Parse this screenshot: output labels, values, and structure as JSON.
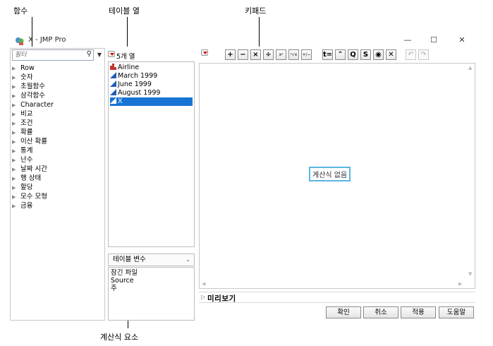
{
  "callouts": {
    "functions": "함수",
    "table_columns": "테이블 열",
    "keypad": "키패드",
    "formula_elements": "계산식 요소"
  },
  "window": {
    "title": "X - JMP Pro",
    "icon": "jmp-app-icon",
    "minimize": "—",
    "maximize": "☐",
    "close": "✕"
  },
  "functions": {
    "search_placeholder": "필터",
    "search_icon": "search-icon",
    "items": [
      "Row",
      "숫자",
      "초월함수",
      "삼각함수",
      "Character",
      "비교",
      "조건",
      "확률",
      "이산 확률",
      "통계",
      "난수",
      "날짜 시간",
      "행 상태",
      "할당",
      "모수 모형",
      "금융"
    ]
  },
  "columns": {
    "count_label": "5개 열",
    "items": [
      {
        "name": "Airline",
        "type": "nominal",
        "color": "#c0392b"
      },
      {
        "name": "March 1999",
        "type": "continuous",
        "color": "#1f5fb3"
      },
      {
        "name": "June 1999",
        "type": "continuous",
        "color": "#1f5fb3"
      },
      {
        "name": "August 1999",
        "type": "continuous",
        "color": "#1f5fb3"
      },
      {
        "name": "X",
        "type": "continuous",
        "color": "#ffffff",
        "selected": true
      }
    ]
  },
  "table_vars": {
    "select_value": "테이블 변수",
    "items": [
      "잠긴 파일",
      "Source",
      "주"
    ]
  },
  "keypad": {
    "buttons": [
      {
        "name": "add-button",
        "label": "+"
      },
      {
        "name": "subtract-button",
        "label": "−"
      },
      {
        "name": "multiply-button",
        "label": "×"
      },
      {
        "name": "divide-button",
        "label": "÷"
      },
      {
        "name": "power-button",
        "label": "xʸ"
      },
      {
        "name": "root-button",
        "label": "ʸ√x"
      },
      {
        "name": "negate-button",
        "label": "+∕−"
      },
      {
        "name": "assign-button",
        "label": "t="
      },
      {
        "name": "caret-button",
        "label": "⌃"
      },
      {
        "name": "local-button",
        "label": "Q"
      },
      {
        "name": "swap-button",
        "label": "S"
      },
      {
        "name": "peel-button",
        "label": "◉"
      },
      {
        "name": "clear-button",
        "label": "✕"
      },
      {
        "name": "undo-button",
        "label": "↶"
      },
      {
        "name": "redo-button",
        "label": "↷"
      }
    ]
  },
  "editor": {
    "empty_text": "계산식 없음",
    "preview_label": "미리보기"
  },
  "buttons": {
    "ok": "확인",
    "cancel": "취소",
    "apply": "적용",
    "help": "도움말"
  }
}
